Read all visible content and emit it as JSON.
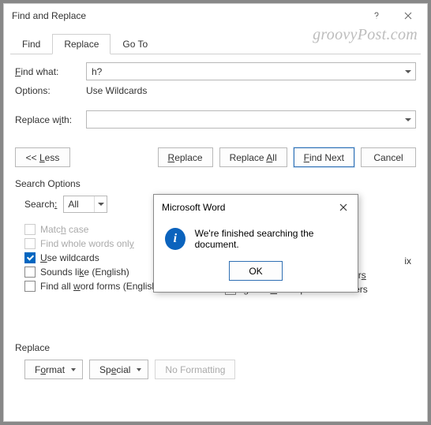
{
  "window": {
    "title": "Find and Replace"
  },
  "watermark": "groovyPost.com",
  "tabs": {
    "find": "Find",
    "replace": "Replace",
    "goto": "Go To"
  },
  "labels": {
    "find_what": "Find what:",
    "options": "Options:",
    "options_value": "Use Wildcards",
    "replace_with": "Replace with:"
  },
  "find_value": "h?",
  "replace_value": "",
  "buttons": {
    "less": "<< Less",
    "replace": "Replace",
    "replace_all": "Replace All",
    "find_next": "Find Next",
    "cancel": "Cancel"
  },
  "search_options": {
    "title": "Search Options",
    "search_label": "Search:",
    "search_value": "All",
    "left": {
      "match_case": "Match case",
      "whole_words": "Find whole words only",
      "use_wildcards": "Use wildcards",
      "sounds_like": "Sounds like (English)",
      "all_word_forms": "Find all word forms (English)"
    },
    "right": {
      "suffix": "ix",
      "ignore_punct": "Ignore punctuation characters",
      "ignore_ws": "Ignore white-space characters"
    }
  },
  "replace_section": {
    "title": "Replace",
    "format": "Format",
    "special": "Special",
    "no_formatting": "No Formatting"
  },
  "modal": {
    "title": "Microsoft Word",
    "message": "We're finished searching the document.",
    "ok": "OK"
  }
}
